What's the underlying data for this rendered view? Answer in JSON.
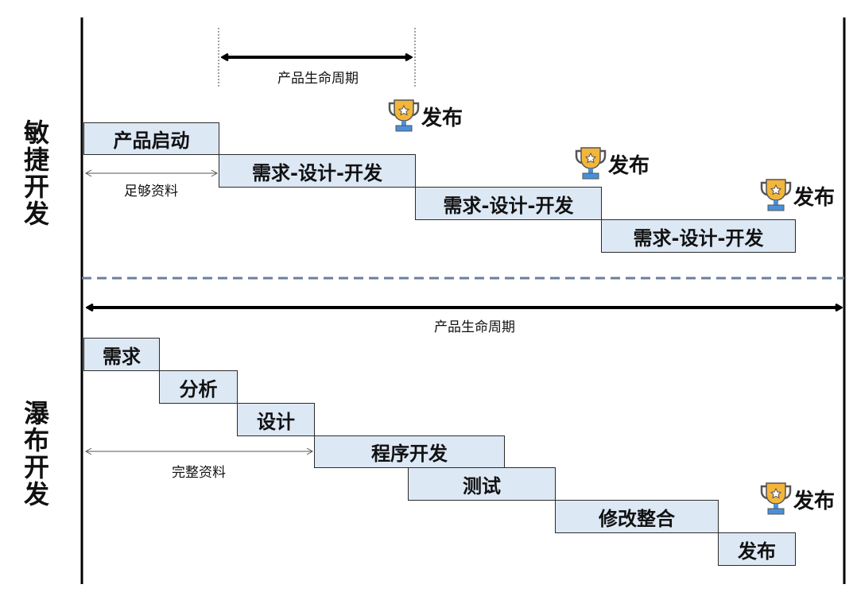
{
  "agile": {
    "title": "敏捷开发",
    "lifecycle_label": "产品生命周期",
    "start_box": "产品启动",
    "info_label": "足够资料",
    "iterations": [
      "需求-设计-开发",
      "需求-设计-开发",
      "需求-设计-开发"
    ],
    "release_label": "发布",
    "icon": "trophy-icon"
  },
  "waterfall": {
    "title": "瀑布开发",
    "lifecycle_label": "产品生命周期",
    "info_label": "完整资料",
    "stages": [
      "需求",
      "分析",
      "设计",
      "程序开发",
      "测试",
      "修改整合",
      "发布"
    ],
    "release_label": "发布",
    "icon": "trophy-icon"
  },
  "colors": {
    "box_fill": "#dde8f5",
    "divider": "#6a7f9a",
    "trophy": "#f3b63a",
    "trophy_base": "#4a90d9"
  }
}
